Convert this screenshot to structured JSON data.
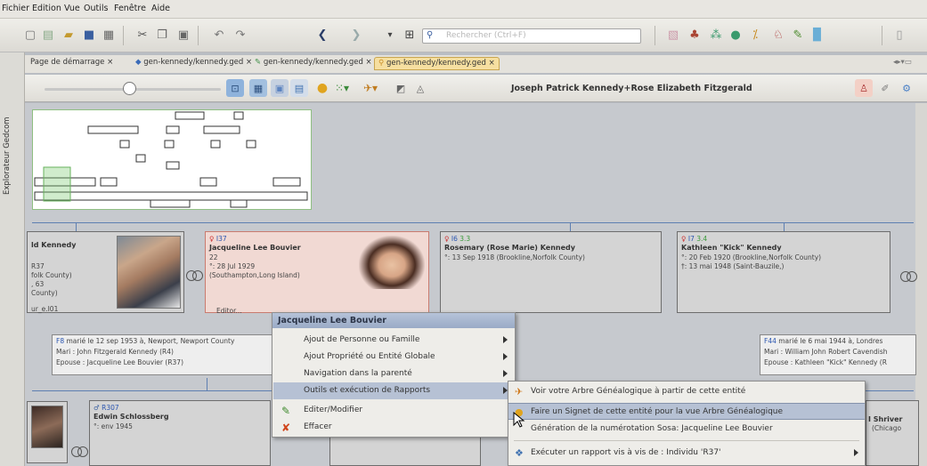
{
  "menubar": [
    "Fichier",
    "Edition",
    "Vue",
    "Outils",
    "Fenêtre",
    "Aide"
  ],
  "toolbar": {
    "search_placeholder": "Rechercher (Ctrl+F)"
  },
  "side_panel": {
    "label": "Explorateur Gedcom"
  },
  "tabs": [
    {
      "label": "Page de démarrage",
      "active": false
    },
    {
      "label": "gen-kennedy/kennedy.ged",
      "active": false
    },
    {
      "label": "gen-kennedy/kennedy.ged",
      "active": false
    },
    {
      "label": "gen-kennedy/kennedy.ged",
      "active": true
    }
  ],
  "tree_toolbar": {
    "couple_title": "Joseph Patrick Kennedy+Rose Elizabeth Fitzgerald"
  },
  "cards": {
    "kennedy": {
      "name": "ld Kennedy",
      "lines": [
        "R37",
        "folk County)",
        ", 63",
        "County)",
        "ur_e.I01"
      ]
    },
    "jacqueline": {
      "id": "I37",
      "name": "Jacqueline Lee Bouvier",
      "lines": [
        "22",
        "°: 28 Jul 1929",
        "(Southampton,Long Island)",
        "Editor..."
      ]
    },
    "rosemary": {
      "id": "I6",
      "gen": "3.3",
      "name": "Rosemary (Rose Marie) Kennedy",
      "lines": [
        "°: 13 Sep 1918  (Brookline,Norfolk County)"
      ]
    },
    "kathleen": {
      "id": "I7",
      "gen": "3.4",
      "name": "Kathleen \"Kick\" Kennedy",
      "lines": [
        "°: 20 Feb 1920  (Brookline,Norfolk County)",
        "†: 13 mai 1948  (Saint-Bauzile,)"
      ]
    },
    "schlossberg": {
      "id": "R307",
      "name": "Edwin Schlossberg",
      "lines": [
        "°: env 1945"
      ]
    },
    "shriver": {
      "name": "I Shriver",
      "lines": [
        "(Chicago"
      ]
    }
  },
  "families": {
    "f1": {
      "id": "F8",
      "lines": [
        "marié le 12 sep 1953 à, Newport, Newport County",
        "Mari : John Fitzgerald Kennedy (R4)",
        "Epouse : Jacqueline Lee Bouvier (R37)"
      ]
    },
    "f2": {
      "id": "F44",
      "lines": [
        "marié le 6 mai 1944 à, Londres",
        "Mari : William John Robert Cavendish",
        "Epouse : Kathleen \"Kick\" Kennedy (R"
      ]
    }
  },
  "context_menu": {
    "title": "Jacqueline Lee Bouvier",
    "items": [
      {
        "label": "Ajout de Personne ou Famille",
        "submenu": true,
        "icon": ""
      },
      {
        "label": "Ajout Propriété ou Entité Globale",
        "submenu": true,
        "icon": ""
      },
      {
        "label": "Navigation dans la parenté",
        "submenu": true,
        "icon": ""
      },
      {
        "label": "Outils et exécution de Rapports",
        "submenu": true,
        "highlighted": true,
        "icon": ""
      },
      {
        "label": "Editer/Modifier",
        "submenu": false,
        "icon": "edit-icon"
      },
      {
        "label": "Effacer",
        "submenu": false,
        "icon": "delete-icon"
      }
    ]
  },
  "submenu": {
    "items": [
      {
        "label": "Voir votre Arbre Généalogique à partir de cette entité",
        "icon": "tree-icon"
      },
      {
        "label": "Faire un Signet de cette entité pour la vue Arbre Généalogique",
        "icon": "bookmark-icon",
        "highlighted": true
      },
      {
        "label": "Génération de la numérotation Sosa: Jacqueline Lee Bouvier",
        "icon": ""
      },
      {
        "label": "Exécuter un rapport vis à vis de : Individu 'R37'",
        "icon": "report-icon",
        "submenu": true
      }
    ]
  },
  "colors": {
    "accent": "#b6c1d4",
    "selected_card": "#f1d9d3",
    "tab_active": "#f6dfa0"
  }
}
